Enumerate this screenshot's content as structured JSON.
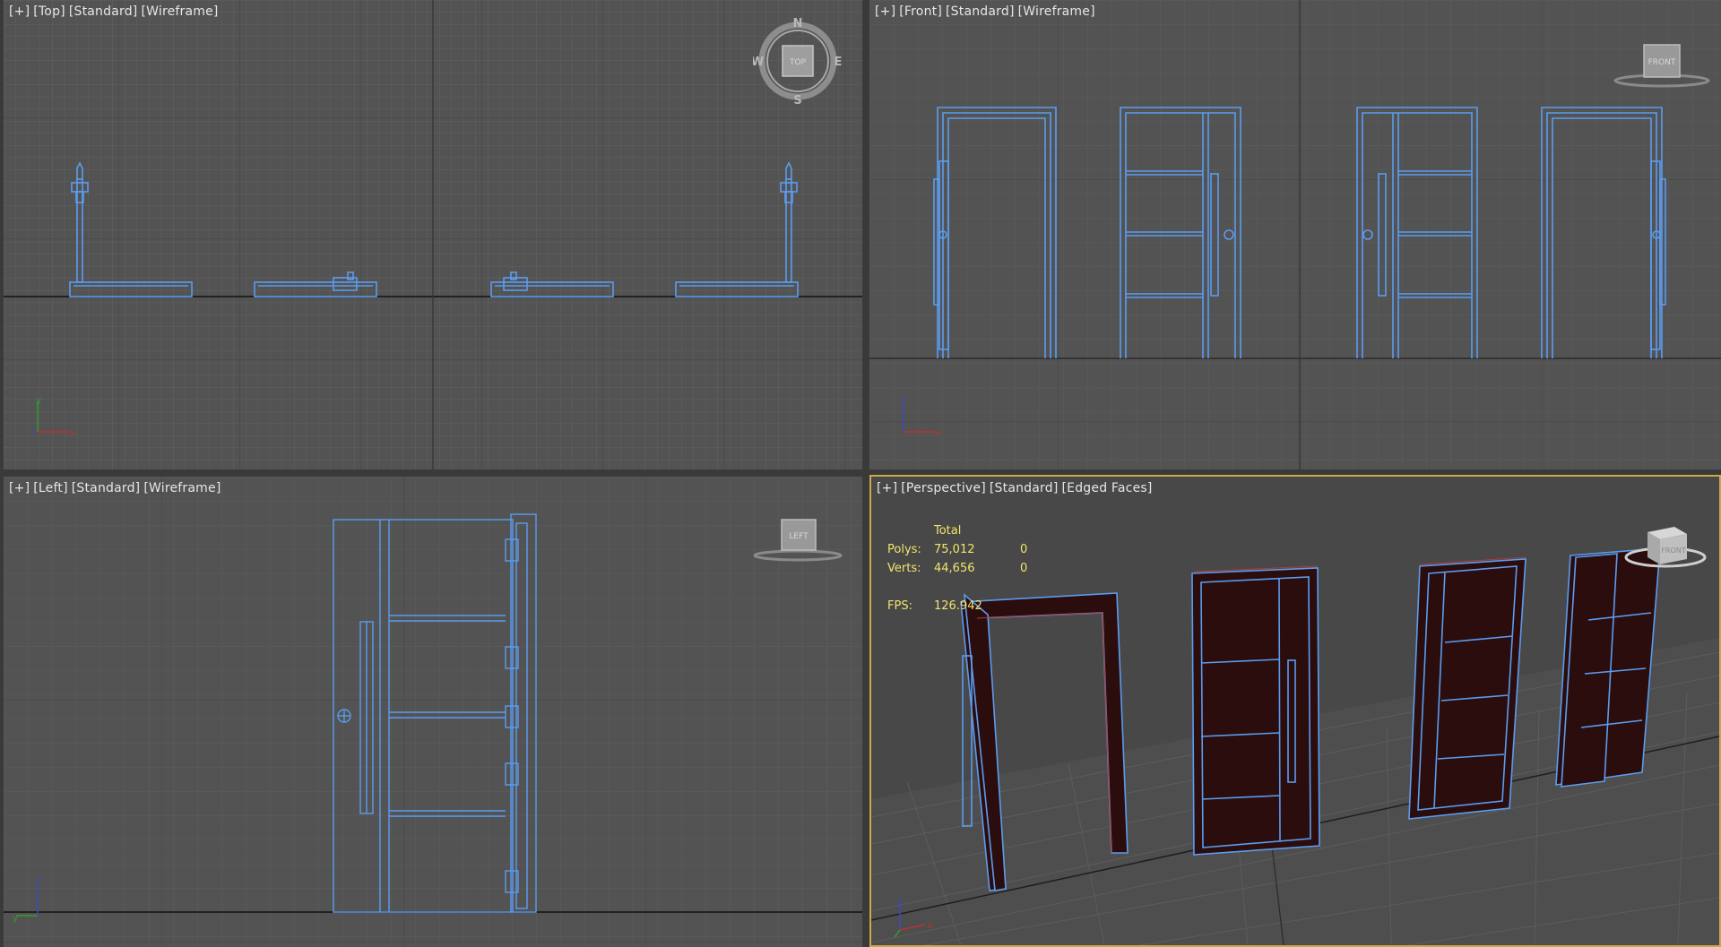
{
  "viewports": {
    "top": {
      "labels": [
        "[+]",
        "[Top]",
        "[Standard]",
        "[Wireframe]"
      ],
      "compass": {
        "n": "N",
        "s": "S",
        "e": "E",
        "w": "W",
        "cube": "TOP"
      }
    },
    "front": {
      "labels": [
        "[+]",
        "[Front]",
        "[Standard]",
        "[Wireframe]"
      ],
      "cube": "FRONT"
    },
    "left": {
      "labels": [
        "[+]",
        "[Left]",
        "[Standard]",
        "[Wireframe]"
      ],
      "cube": "LEFT"
    },
    "persp": {
      "labels": [
        "[+]",
        "[Perspective]",
        "[Standard]",
        "[Edged Faces]"
      ],
      "cube": "FRONT"
    }
  },
  "stats": {
    "header": "Total",
    "polys_label": "Polys:",
    "polys_value": "75,012",
    "polys_sel": "0",
    "verts_label": "Verts:",
    "verts_value": "44,656",
    "verts_sel": "0",
    "fps_label": "FPS:",
    "fps_value": "126.942"
  },
  "gizmo": {
    "x": "x",
    "y": "y",
    "z": "z"
  },
  "colors": {
    "background": "#535353",
    "grid_minor": "#5e5e5e",
    "grid_major": "#454545",
    "wire": "#5b9cf0",
    "door_fill": "#2b0d0d",
    "active_border": "#c9a94d",
    "stats_text": "#f2e46c"
  }
}
